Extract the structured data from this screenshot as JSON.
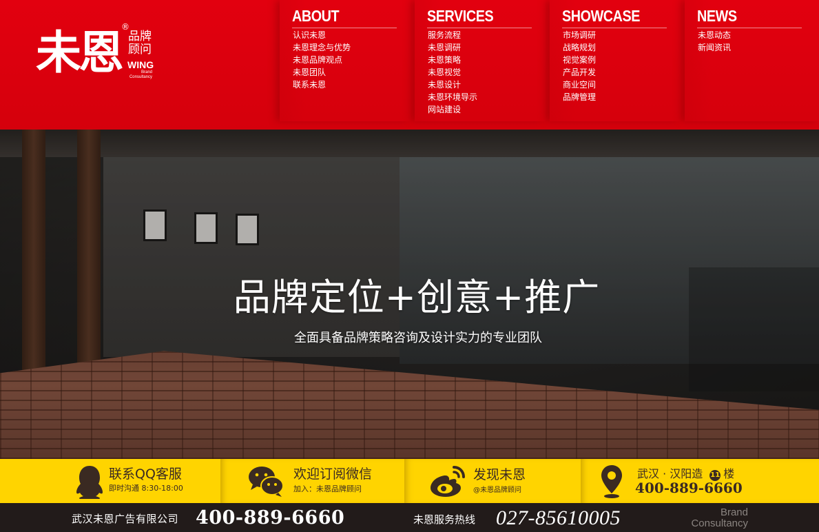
{
  "colors": {
    "header_red": "#e2000f",
    "contact_yellow": "#ffd400",
    "footer_dark": "#221b1a",
    "contact_text": "#3a2a22"
  },
  "logo": {
    "main": "未恩",
    "registered": "®",
    "small_text": "品牌顾问",
    "wing": "WING",
    "brand_line1": "Brand",
    "brand_line2": "Consultancy"
  },
  "nav": [
    {
      "title": "ABOUT",
      "items": [
        "认识未恩",
        "未恩理念与优势",
        "未恩品牌观点",
        "未恩团队",
        "联系未恩"
      ]
    },
    {
      "title": "SERVICES",
      "items": [
        "服务流程",
        "未恩调研",
        "未恩策略",
        "未恩视觉",
        "未恩设计",
        "未恩环境导示",
        "网站建设"
      ]
    },
    {
      "title": "SHOWCASE",
      "items": [
        "市场调研",
        "战略规划",
        "视觉案例",
        "产品开发",
        "商业空间",
        "品牌管理"
      ]
    },
    {
      "title": "NEWS",
      "items": [
        "未恩动态",
        "新闻资讯"
      ]
    }
  ],
  "hero": {
    "title": "品牌定位+创意+推广",
    "subtitle": "全面具备品牌策略咨询及设计实力的专业团队"
  },
  "contact": {
    "qq": {
      "icon": "qq-penguin-icon",
      "title": "联系QQ客服",
      "sub": "即时沟通 8:30-18:00"
    },
    "wechat": {
      "icon": "wechat-icon",
      "title": "欢迎订阅微信",
      "sub": "加入：未恩品牌顾问"
    },
    "weibo": {
      "icon": "weibo-icon",
      "title": "发现未恩",
      "sub": "@未恩品牌顾问"
    },
    "location": {
      "icon": "location-pin-icon",
      "address": "武汉 · 汉阳造",
      "floor_num": "11",
      "floor_unit": "楼",
      "phone": "400-889-6660"
    }
  },
  "footer": {
    "company": "武汉未恩广告有限公司",
    "phone": "400-889-6660",
    "hotline_label": "未恩服务热线",
    "hotline": "027-85610005",
    "brand_line1": "Brand",
    "brand_line2": "Consultancy"
  }
}
